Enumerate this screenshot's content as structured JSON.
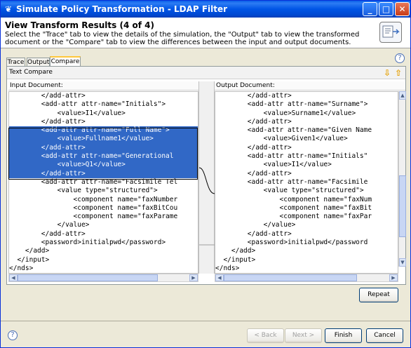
{
  "window": {
    "title": "Simulate Policy Transformation - LDAP Filter"
  },
  "header": {
    "title": "View Transform Results (4 of 4)",
    "description": "Select the \"Trace\" tab to view the details of the simulation, the \"Output\" tab to view the transformed document or the \"Compare\" tab to view the differences between the input and output documents."
  },
  "tabs": [
    {
      "label": "Trace",
      "active": false
    },
    {
      "label": "Output",
      "active": false
    },
    {
      "label": "Compare",
      "active": true
    }
  ],
  "compare": {
    "title": "Text Compare",
    "input_label": "Input Document:",
    "output_label": "Output Document:"
  },
  "input_lines": [
    "        </add-attr>",
    "        <add-attr attr-name=\"Initials\">",
    "            <value>I1</value>",
    "        </add-attr>",
    "        <add-attr attr-name=\"Full Name\">",
    "            <value>Fullname1</value>",
    "        </add-attr>",
    "        <add-attr attr-name=\"Generational",
    "            <value>Q1</value>",
    "        </add-attr>",
    "        <add-attr attr-name=\"Facsimile Tel",
    "            <value type=\"structured\">",
    "                <component name=\"faxNumber",
    "                <component name=\"faxBitCou",
    "                <component name=\"faxParame",
    "            </value>",
    "        </add-attr>",
    "        <password>initialpwd</password>",
    "    </add>",
    "  </input>",
    "</nds>"
  ],
  "output_lines": [
    "        </add-attr>",
    "        <add-attr attr-name=\"Surname\">",
    "            <value>Surname1</value>",
    "        </add-attr>",
    "        <add-attr attr-name=\"Given Name",
    "            <value>Given1</value>",
    "        </add-attr>",
    "        <add-attr attr-name=\"Initials\"",
    "            <value>I1</value>",
    "        </add-attr>",
    "        <add-attr attr-name=\"Facsimile",
    "            <value type=\"structured\">",
    "                <component name=\"faxNum",
    "                <component name=\"faxBit",
    "                <component name=\"faxPar",
    "            </value>",
    "        </add-attr>",
    "        <password>initialpwd</password",
    "    </add>",
    "  </input>",
    "</nds>"
  ],
  "buttons": {
    "repeat": "Repeat",
    "back": "< Back",
    "next": "Next >",
    "finish": "Finish",
    "cancel": "Cancel"
  },
  "colors": {
    "selection": "#3168C6",
    "titlebar": "#0055E5",
    "arrows": "#E5A000"
  },
  "icons": {
    "help": "help-icon",
    "next-diff": "arrow-down-icon",
    "prev-diff": "arrow-up-icon"
  },
  "glyphs": {
    "help": "?",
    "next_diff": "⇩",
    "prev_diff": "⇧",
    "minimize": "_",
    "maximize": "□",
    "close": "✕",
    "app": "❦"
  }
}
